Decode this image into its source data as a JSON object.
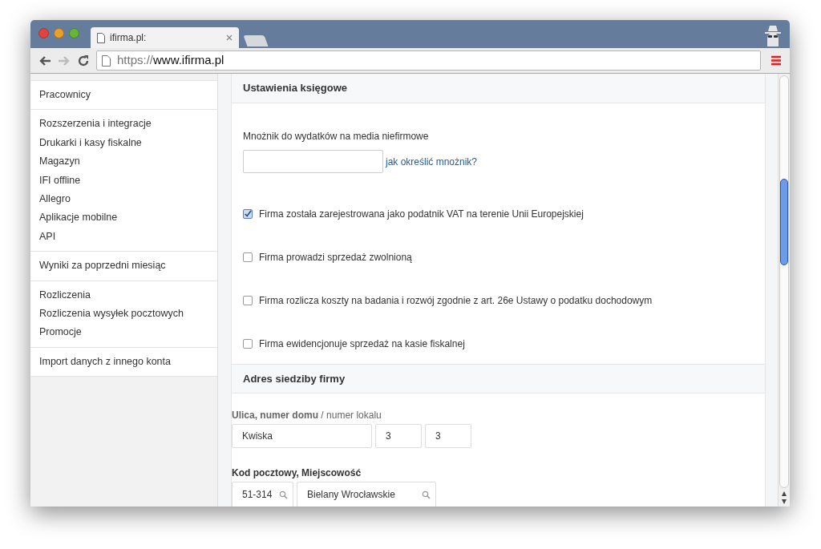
{
  "browser": {
    "tab_title": "ifirma.pl:",
    "url": {
      "scheme": "https://",
      "host": "www.ifirma.pl"
    }
  },
  "sidebar": {
    "groups": [
      {
        "items": [
          "Pracownicy"
        ]
      },
      {
        "items": [
          "Rozszerzenia i integracje",
          "Drukarki i kasy fiskalne",
          "Magazyn",
          "IFI offline",
          "Allegro",
          "Aplikacje mobilne",
          "API"
        ]
      },
      {
        "items": [
          "Wyniki za poprzedni miesiąc"
        ]
      },
      {
        "items": [
          "Rozliczenia",
          "Rozliczenia wysyłek pocztowych",
          "Promocje"
        ]
      },
      {
        "items": [
          "Import danych z innego konta"
        ]
      }
    ]
  },
  "accounting": {
    "title": "Ustawienia księgowe",
    "multiplier_label": "Mnożnik do wydatków na media niefirmowe",
    "help_link": "jak określić mnożnik?",
    "checkboxes": [
      {
        "label": "Firma została zarejestrowana jako podatnik VAT na terenie Unii Europejskiej",
        "checked": true
      },
      {
        "label": "Firma prowadzi sprzedaż zwolnioną",
        "checked": false
      },
      {
        "label": "Firma rozlicza koszty na badania i rozwój zgodnie z art. 26e Ustawy o podatku dochodowym",
        "checked": false
      },
      {
        "label": "Firma ewidencjonuje sprzedaż na kasie fiskalnej",
        "checked": false
      }
    ]
  },
  "address": {
    "title": "Adres siedziby firmy",
    "street_label": "**Ulica, numer domu** / numer lokalu",
    "street": "Kwiska",
    "house_number": "3",
    "apartment_number": "3",
    "postal_label": "Kod pocztowy, Miejscowość",
    "postal_code": "51-314",
    "city": "Bielany Wrocławskie"
  }
}
